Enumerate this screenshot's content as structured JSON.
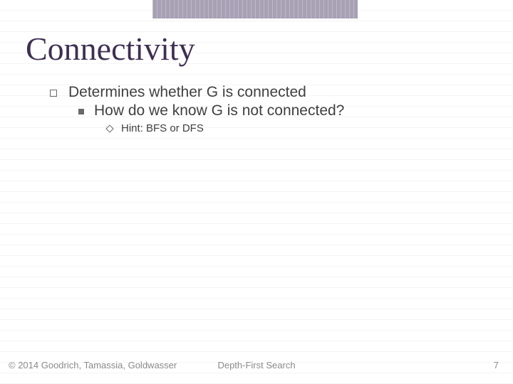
{
  "title": "Connectivity",
  "bullets": {
    "lvl1": "Determines whether G is connected",
    "lvl2": "How do we know G is not connected?",
    "lvl3": "Hint: BFS or DFS"
  },
  "footer": {
    "copyright": "© 2014 Goodrich, Tamassia, Goldwasser",
    "center": "Depth-First Search",
    "page": "7"
  }
}
